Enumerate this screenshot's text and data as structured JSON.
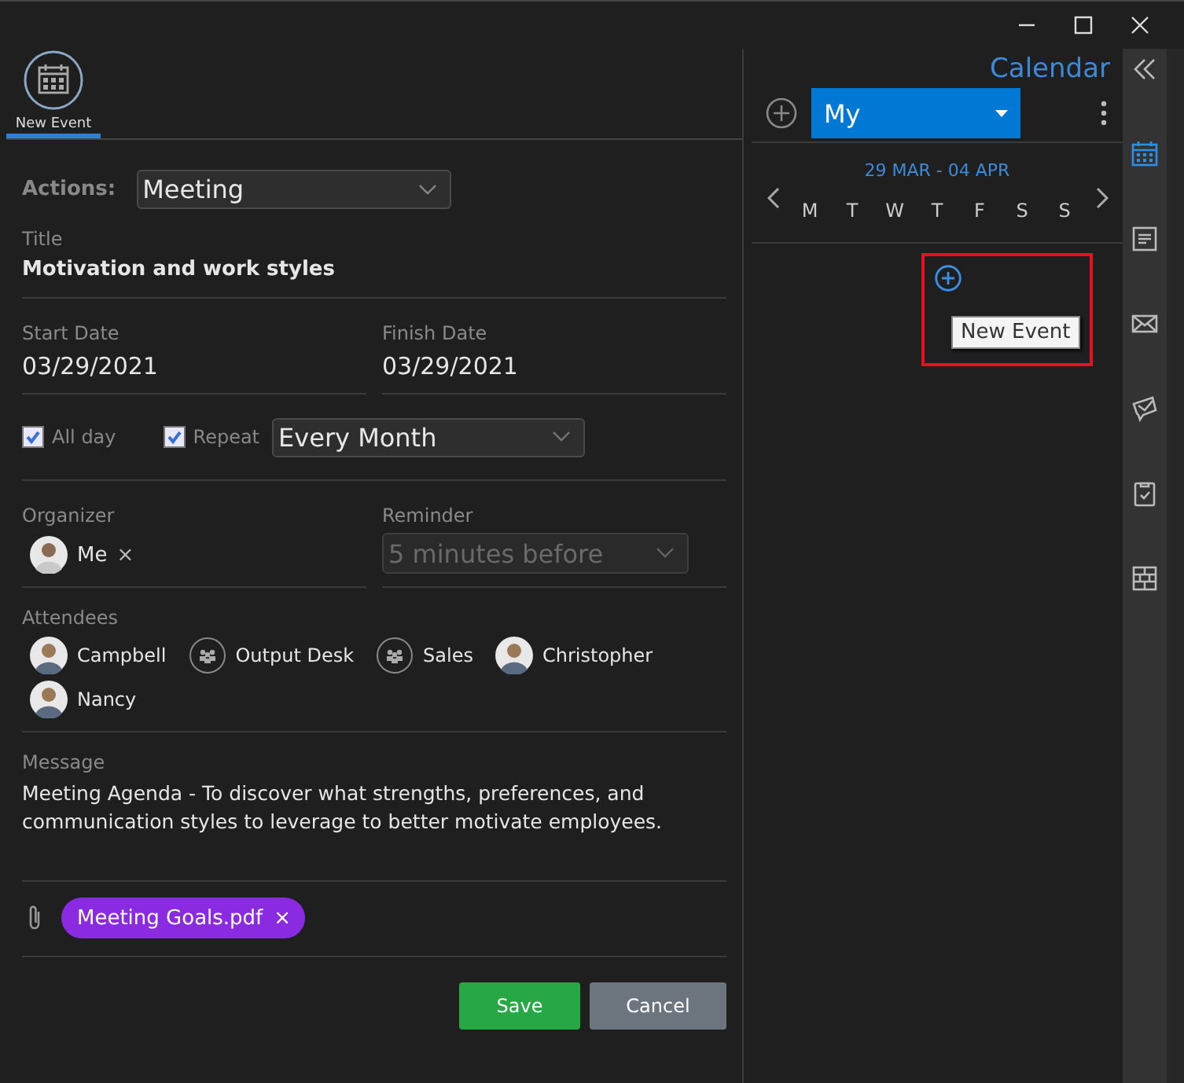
{
  "ribbon": {
    "label": "New Event",
    "selected": true
  },
  "actions": {
    "label": "Actions:",
    "value": "Meeting"
  },
  "title_field": {
    "label": "Title",
    "value": "Motivation and work styles"
  },
  "start_date": {
    "label": "Start Date",
    "value": "03/29/2021"
  },
  "finish_date": {
    "label": "Finish Date",
    "value": "03/29/2021"
  },
  "all_day": {
    "label": "All day",
    "checked": true
  },
  "repeat": {
    "label": "Repeat",
    "checked": true,
    "value": "Every Month"
  },
  "organizer": {
    "label": "Organizer",
    "name": "Me",
    "remove": "×"
  },
  "reminder": {
    "label": "Reminder",
    "value": "5 minutes before",
    "disabled": true
  },
  "attendees": {
    "label": "Attendees",
    "items": [
      {
        "name": "Campbell",
        "kind": "person"
      },
      {
        "name": "Output Desk",
        "kind": "group"
      },
      {
        "name": "Sales",
        "kind": "group"
      },
      {
        "name": "Christopher",
        "kind": "person"
      },
      {
        "name": "Nancy",
        "kind": "person"
      }
    ]
  },
  "message": {
    "label": "Message",
    "text": "Meeting Agenda - To discover what strengths, preferences, and communication styles to leverage to better motivate employees."
  },
  "attachment": {
    "name": "Meeting Goals.pdf",
    "remove": "×",
    "color": "#8a2be2"
  },
  "buttons": [
    {
      "label": "Save",
      "kind": "primary"
    },
    {
      "label": "Cancel",
      "kind": "secondary"
    }
  ],
  "calendar": {
    "title": "Calendar",
    "view": "My",
    "range": "29 MAR - 04 APR",
    "days": [
      "M",
      "T",
      "W",
      "T",
      "F",
      "S",
      "S"
    ],
    "tooltip": "New Event"
  },
  "rail": [
    {
      "kind": "collapse",
      "selected": false
    },
    {
      "kind": "calendar",
      "selected": true
    },
    {
      "kind": "note",
      "selected": false
    },
    {
      "kind": "mail",
      "selected": false
    },
    {
      "kind": "chat",
      "selected": false
    },
    {
      "kind": "task",
      "selected": false
    },
    {
      "kind": "grid",
      "selected": false
    }
  ]
}
